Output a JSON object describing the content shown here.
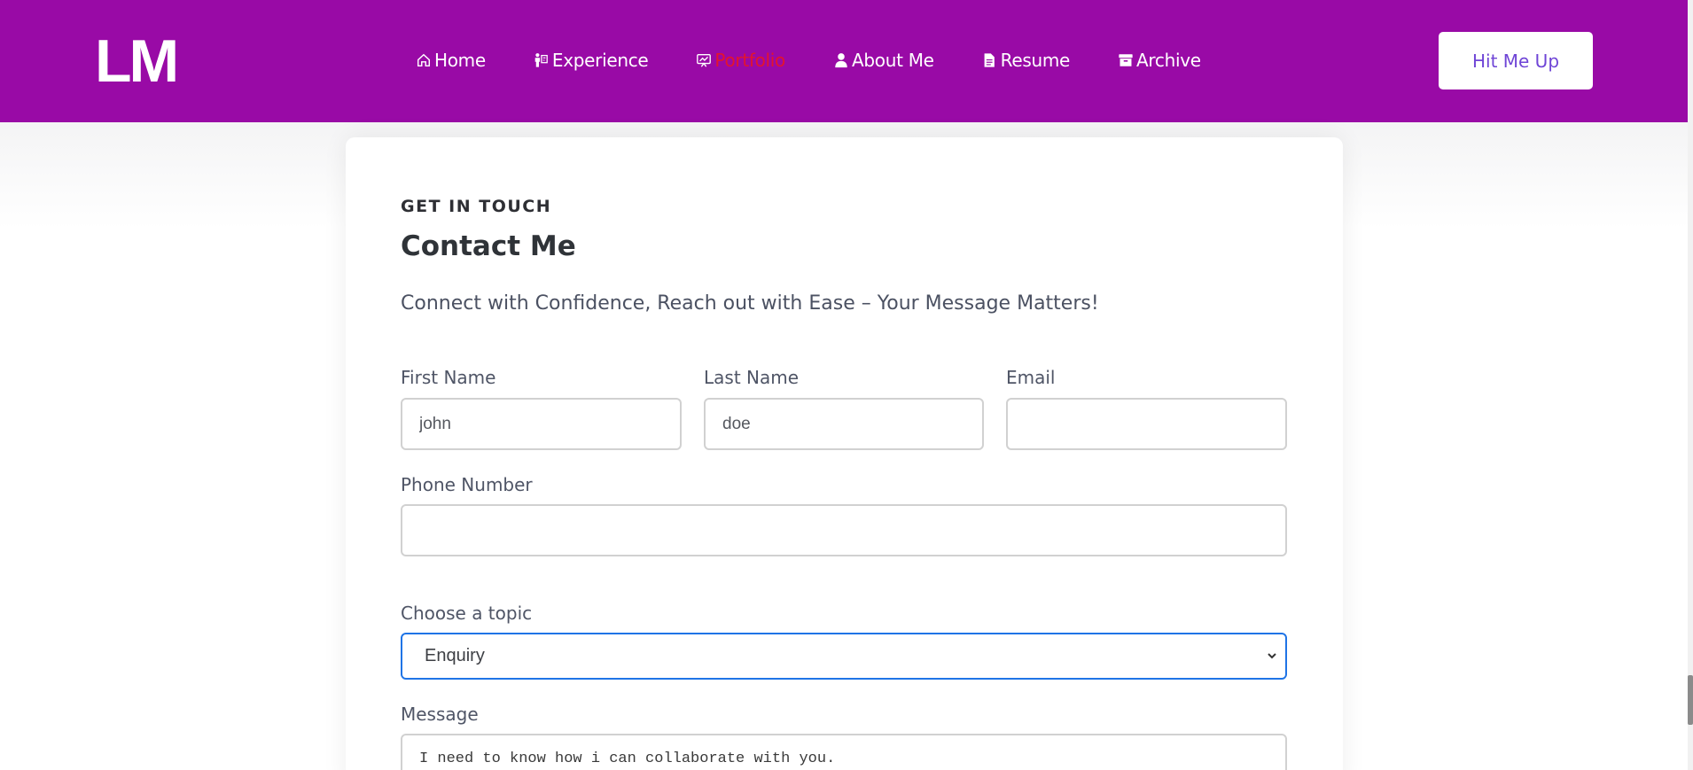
{
  "header": {
    "logo": "LM",
    "nav": [
      {
        "label": "Home",
        "icon": "home-icon",
        "active": false
      },
      {
        "label": "Experience",
        "icon": "presenter-icon",
        "active": false
      },
      {
        "label": "Portfolio",
        "icon": "presentation-chart-icon",
        "active": true
      },
      {
        "label": "About Me",
        "icon": "user-icon",
        "active": false
      },
      {
        "label": "Resume",
        "icon": "document-icon",
        "active": false
      },
      {
        "label": "Archive",
        "icon": "archive-box-icon",
        "active": false
      }
    ],
    "cta_label": "Hit Me Up",
    "colors": {
      "background": "#990aa6",
      "active_nav": "#e3142e",
      "cta_text": "#6f45d6"
    }
  },
  "contact": {
    "eyebrow": "GET IN TOUCH",
    "title": "Contact Me",
    "subtitle": "Connect with Confidence, Reach out with Ease – Your Message Matters!",
    "first_name": {
      "label": "First Name",
      "value": "john"
    },
    "last_name": {
      "label": "Last Name",
      "value": "doe"
    },
    "email": {
      "label": "Email",
      "value": ""
    },
    "phone": {
      "label": "Phone Number",
      "value": ""
    },
    "topic": {
      "label": "Choose a topic",
      "selected": "Enquiry"
    },
    "message": {
      "label": "Message",
      "value": "I need to know how i can collaborate with you."
    }
  }
}
